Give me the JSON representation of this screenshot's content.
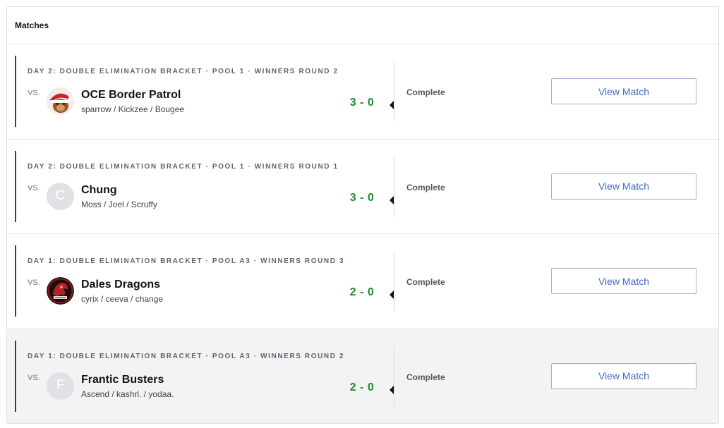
{
  "panel": {
    "title": "Matches"
  },
  "matches": [
    {
      "stage": "DAY 2: DOUBLE ELIMINATION BRACKET · POOL 1 · WINNERS ROUND 2",
      "vs": "VS.",
      "avatar_icon": "santa-hat-mascot-logo",
      "avatar_letter": "",
      "team": "OCE Border Patrol",
      "roster": "sparrow / Kickzee / Bougee",
      "score": "3 - 0",
      "status": "Complete",
      "button": "View Match"
    },
    {
      "stage": "DAY 2: DOUBLE ELIMINATION BRACKET · POOL 1 · WINNERS ROUND 1",
      "vs": "VS.",
      "avatar_icon": "letter-avatar",
      "avatar_letter": "C",
      "team": "Chung",
      "roster": "Moss / Joel / Scruffy",
      "score": "3 - 0",
      "status": "Complete",
      "button": "View Match"
    },
    {
      "stage": "DAY 1: DOUBLE ELIMINATION BRACKET · POOL A3 · WINNERS ROUND 3",
      "vs": "VS.",
      "avatar_icon": "dragon-logo",
      "avatar_letter": "",
      "team": "Dales Dragons",
      "roster": "cyrix / ceeva / change",
      "score": "2 - 0",
      "status": "Complete",
      "button": "View Match"
    },
    {
      "stage": "DAY 1: DOUBLE ELIMINATION BRACKET · POOL A3 · WINNERS ROUND 2",
      "vs": "VS.",
      "avatar_icon": "letter-avatar",
      "avatar_letter": "F",
      "team": "Frantic Busters",
      "roster": "Ascend / kashrl. / yodaa.",
      "score": "2 - 0",
      "status": "Complete",
      "button": "View Match"
    }
  ],
  "colors": {
    "score_win": "#1d8a33",
    "button_text": "#3e6fc0",
    "button_border": "#9bb1cf",
    "row_highlight": "#f3f3f3"
  }
}
